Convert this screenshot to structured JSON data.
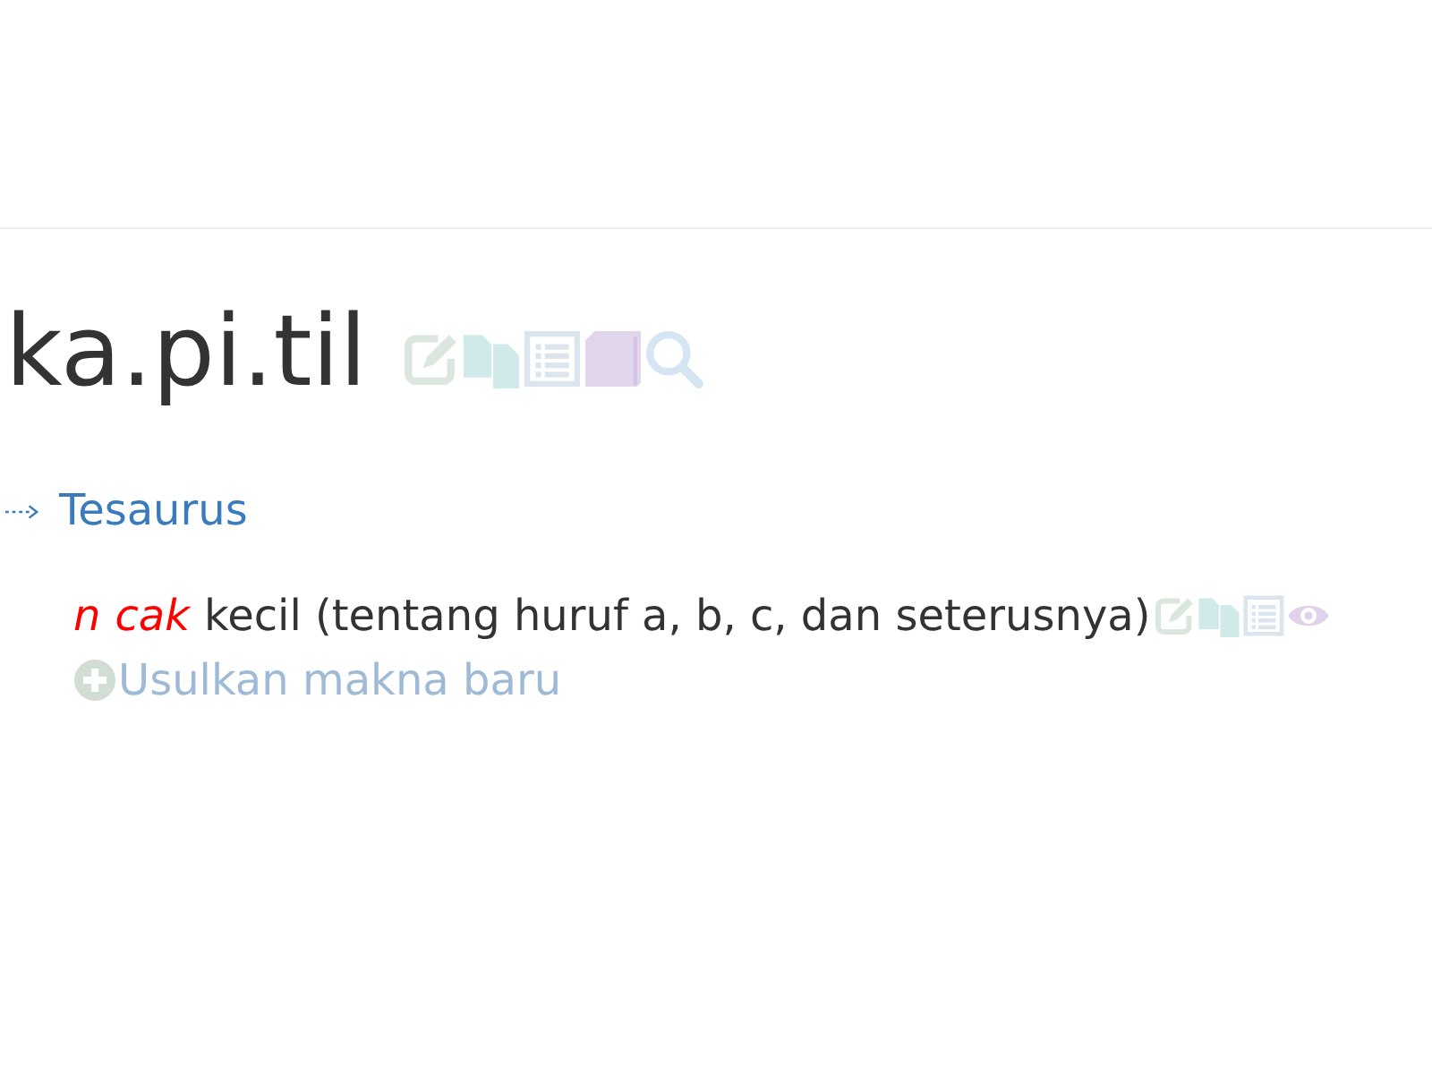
{
  "headword": "ka.pi.til",
  "thesaurus_link": {
    "label": "Tesaurus"
  },
  "senses": [
    {
      "labels": [
        "n",
        "cak"
      ],
      "definition": "kecil (tentang huruf a, b, c, dan seterusnya)"
    }
  ],
  "suggest_link": {
    "label": "Usulkan makna baru"
  }
}
